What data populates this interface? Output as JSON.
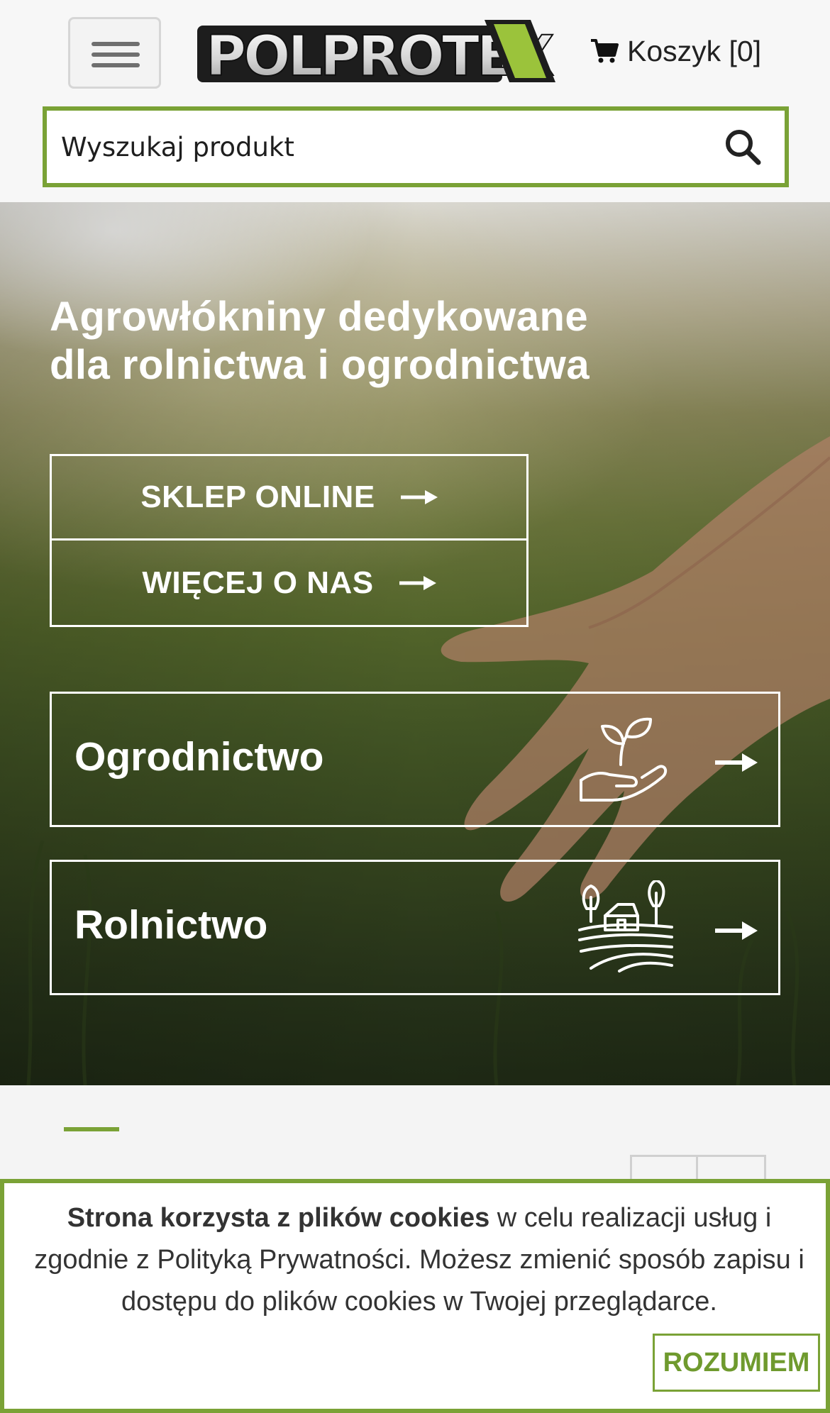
{
  "header": {
    "menu_icon": "hamburger-menu-icon",
    "logo_text": "POLPROTEX",
    "cart": {
      "label": "Koszyk [0]",
      "icon": "cart-icon"
    },
    "search": {
      "placeholder": "Wyszukaj produkt",
      "value": "",
      "icon": "search-icon"
    }
  },
  "hero": {
    "title_line1": "Agrowłókniny dedykowane",
    "title_line2": "dla rolnictwa i ogrodnictwa",
    "buttons": [
      {
        "label": "SKLEP ONLINE",
        "icon": "arrow-right-icon"
      },
      {
        "label": "WIĘCEJ O NAS",
        "icon": "arrow-right-icon"
      }
    ],
    "categories": [
      {
        "label": "Ogrodnictwo",
        "icon": "plant-in-hand-icon"
      },
      {
        "label": "Rolnictwo",
        "icon": "farm-landscape-icon"
      }
    ]
  },
  "slider": {
    "prev_icon": "chevron-left-icon",
    "next_icon": "chevron-right-icon",
    "prev_symbol": "‹",
    "next_symbol": "›"
  },
  "cookie": {
    "bold": "Strona korzysta z plików cookies",
    "text": " w celu realizacji usług i zgodnie z Polityką Prywatności. Możesz zmienić sposób zapisu i dostępu do plików cookies w Twojej przeglądarce.",
    "button": "ROZUMIEM"
  },
  "colors": {
    "accent": "#7aa236",
    "white": "#ffffff",
    "text": "#222222"
  }
}
